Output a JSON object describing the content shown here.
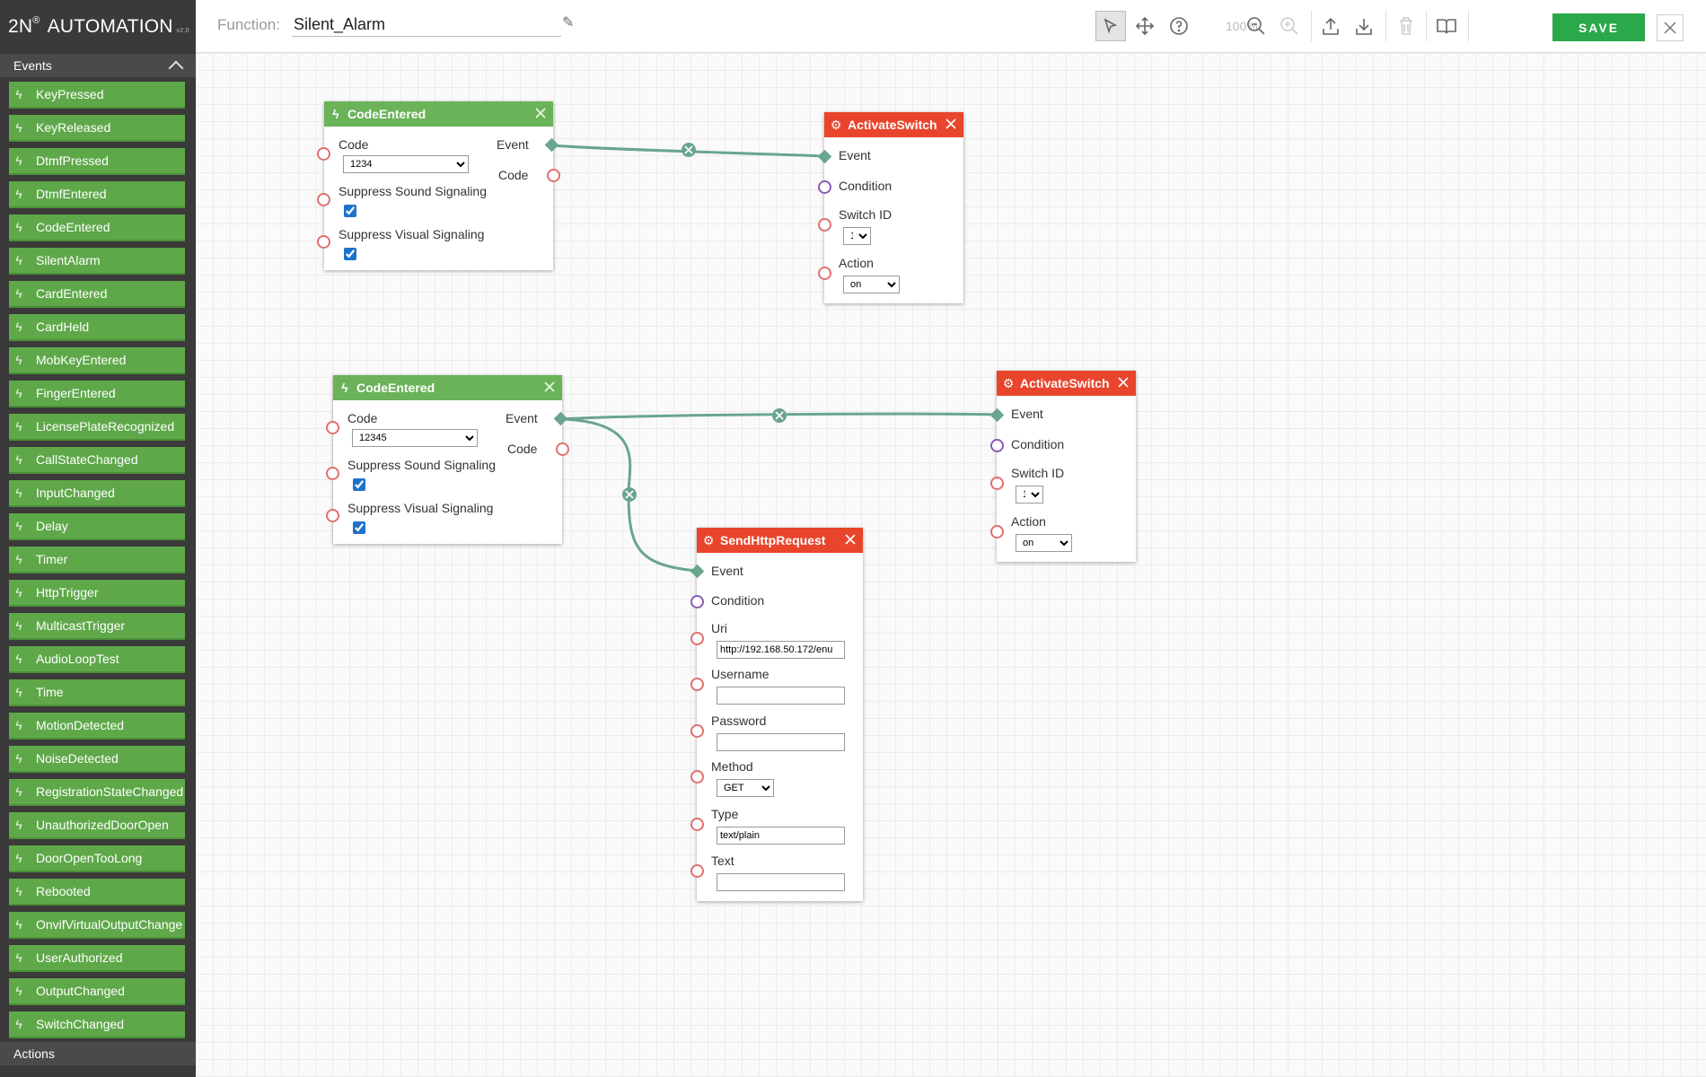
{
  "app": {
    "brand": "2N",
    "brand_reg": "®",
    "brand_suffix": "AUTOMATION",
    "version": "v2.0"
  },
  "toolbar": {
    "function_label": "Function:",
    "function_name": "Silent_Alarm",
    "zoom": "100%",
    "save_label": "SAVE"
  },
  "sidebar": {
    "events_title": "Events",
    "actions_title": "Actions",
    "events": [
      "KeyPressed",
      "KeyReleased",
      "DtmfPressed",
      "DtmfEntered",
      "CodeEntered",
      "SilentAlarm",
      "CardEntered",
      "CardHeld",
      "MobKeyEntered",
      "FingerEntered",
      "LicensePlateRecognized",
      "CallStateChanged",
      "InputChanged",
      "Delay",
      "Timer",
      "HttpTrigger",
      "MulticastTrigger",
      "AudioLoopTest",
      "Time",
      "MotionDetected",
      "NoiseDetected",
      "RegistrationStateChanged",
      "UnauthorizedDoorOpen",
      "DoorOpenTooLong",
      "Rebooted",
      "OnvifVirtualOutputChange",
      "UserAuthorized",
      "OutputChanged",
      "SwitchChanged"
    ]
  },
  "nodes": {
    "code1": {
      "title": "CodeEntered",
      "code_label": "Code",
      "code_value": "1234",
      "sound_label": "Suppress Sound Signaling",
      "visual_label": "Suppress Visual Signaling",
      "out_event": "Event",
      "out_code": "Code"
    },
    "switch1": {
      "title": "ActivateSwitch",
      "event": "Event",
      "condition": "Condition",
      "switch_label": "Switch ID",
      "switch_value": "1",
      "action_label": "Action",
      "action_value": "on"
    },
    "code2": {
      "title": "CodeEntered",
      "code_label": "Code",
      "code_value": "12345",
      "sound_label": "Suppress Sound Signaling",
      "visual_label": "Suppress Visual Signaling",
      "out_event": "Event",
      "out_code": "Code"
    },
    "switch2": {
      "title": "ActivateSwitch",
      "event": "Event",
      "condition": "Condition",
      "switch_label": "Switch ID",
      "switch_value": "1",
      "action_label": "Action",
      "action_value": "on"
    },
    "http": {
      "title": "SendHttpRequest",
      "event": "Event",
      "condition": "Condition",
      "uri_label": "Uri",
      "uri_value": "http://192.168.50.172/enu",
      "username_label": "Username",
      "password_label": "Password",
      "method_label": "Method",
      "method_value": "GET",
      "type_label": "Type",
      "type_value": "text/plain",
      "text_label": "Text"
    }
  },
  "colors": {
    "event_header": "#6bb359",
    "action_header": "#e8452c",
    "wire": "#6aa58e",
    "sidebar_item": "#5fa84a",
    "save": "#2ba84a"
  },
  "icons": {
    "event": "bolt-icon",
    "action": "gear-icon"
  }
}
